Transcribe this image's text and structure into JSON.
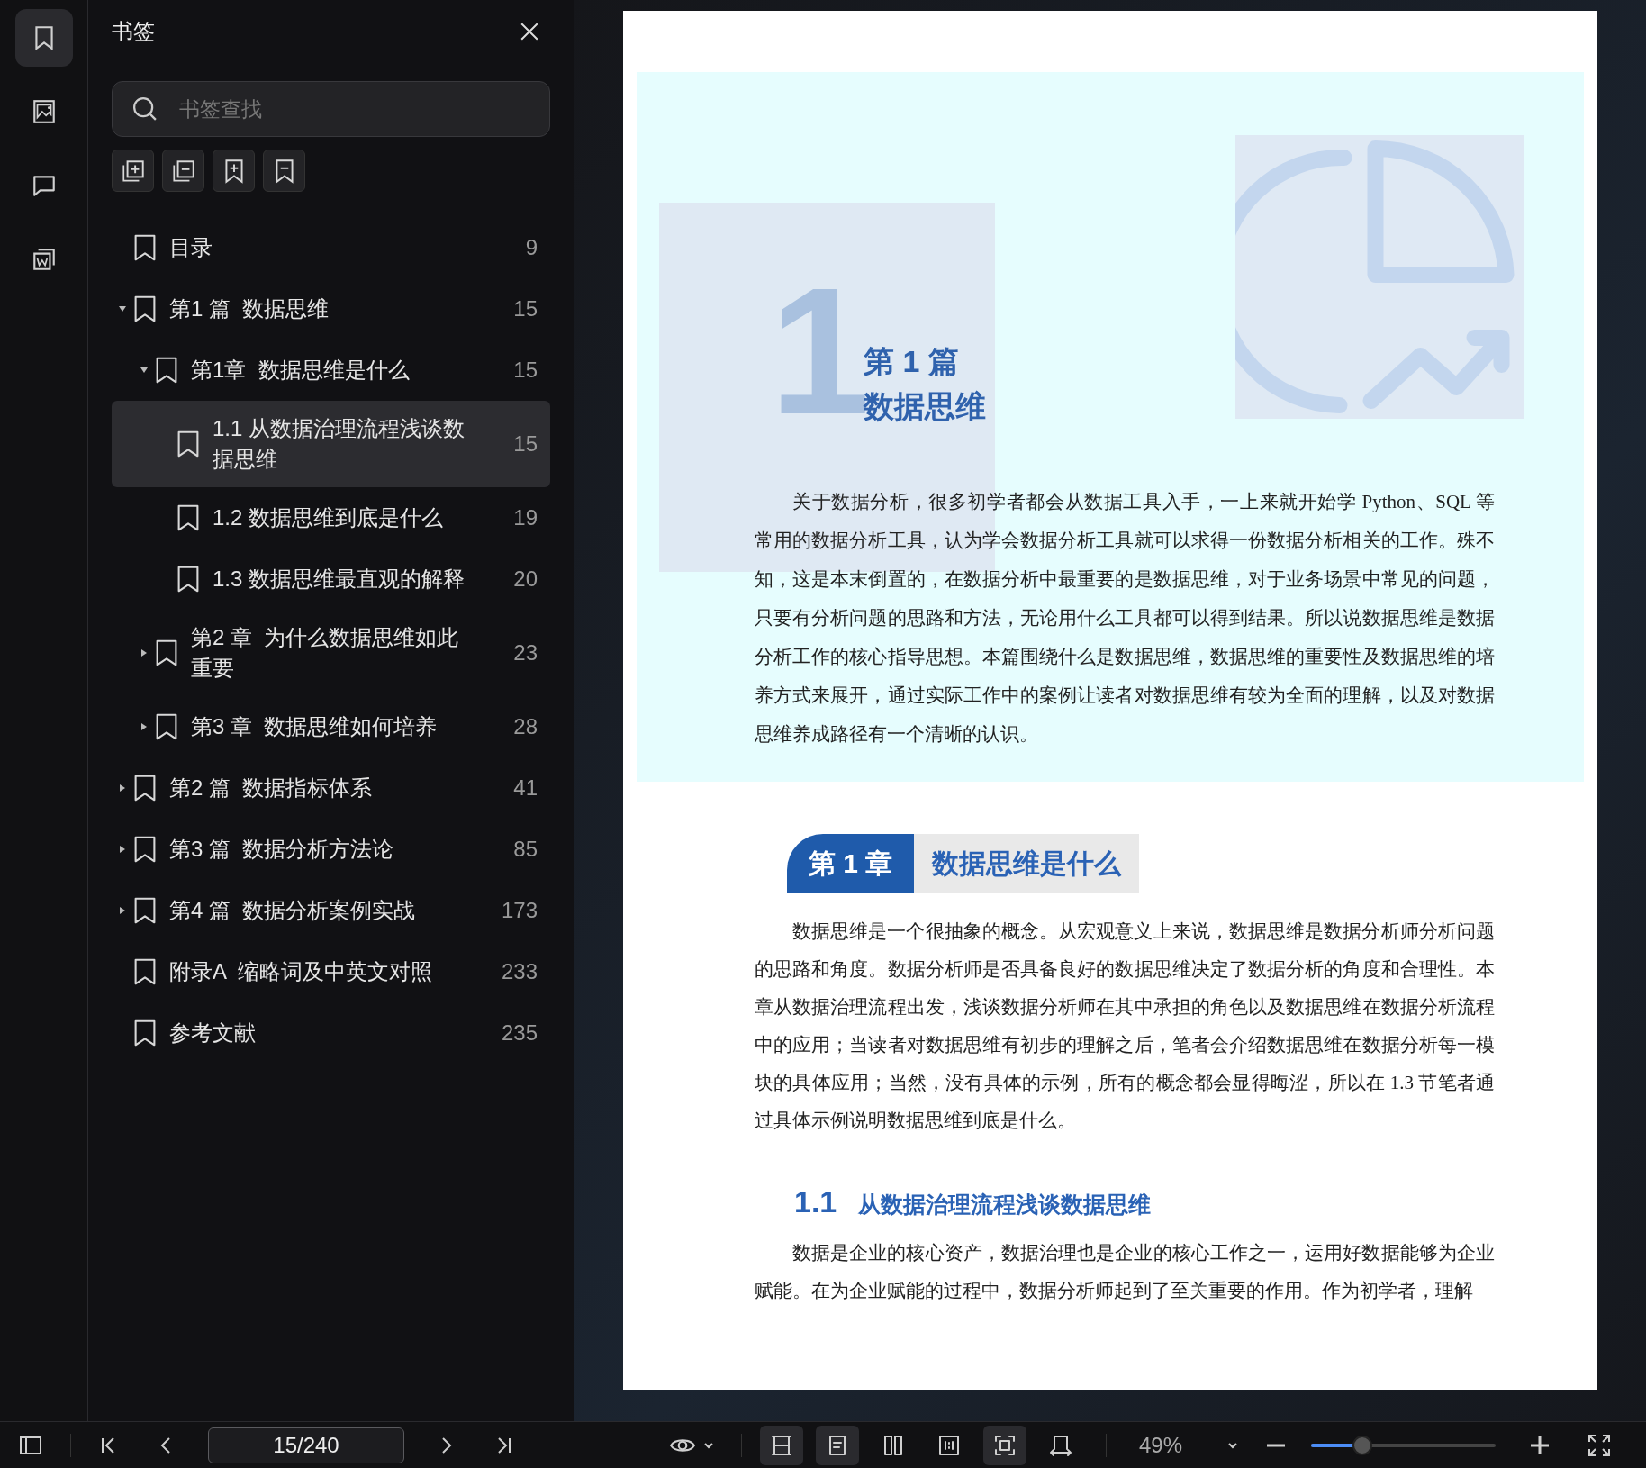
{
  "rail": [
    {
      "kind": "bookmark",
      "selected": true
    },
    {
      "kind": "image",
      "selected": false
    },
    {
      "kind": "comment",
      "selected": false
    },
    {
      "kind": "extract",
      "selected": false
    }
  ],
  "sidebar": {
    "title": "书签",
    "search": {
      "placeholder": "书签查找"
    },
    "tools": [
      {
        "kind": "expand-all"
      },
      {
        "kind": "collapse-all"
      },
      {
        "kind": "add-bookmark"
      },
      {
        "kind": "remove-bookmark"
      }
    ],
    "bookmarks": [
      {
        "title": "目录",
        "page": "9",
        "selected": false
      },
      {
        "title": "第1 篇  数据思维",
        "page": "15",
        "selected": false,
        "expanded": true,
        "children": [
          {
            "title": "第1章  数据思维是什么",
            "page": "15",
            "selected": false,
            "expanded": true,
            "children": [
              {
                "title": "1.1 从数据治理流程浅谈数据思维",
                "page": "15",
                "selected": true
              },
              {
                "title": "1.2 数据思维到底是什么",
                "page": "19",
                "selected": false
              },
              {
                "title": "1.3 数据思维最直观的解释",
                "page": "20",
                "selected": false
              }
            ]
          },
          {
            "title": "第2 章  为什么数据思维如此重要",
            "page": "23",
            "selected": false,
            "expanded": false
          },
          {
            "title": "第3 章  数据思维如何培养",
            "page": "28",
            "selected": false,
            "expanded": false
          }
        ]
      },
      {
        "title": "第2 篇  数据指标体系",
        "page": "41",
        "selected": false,
        "expanded": false
      },
      {
        "title": "第3 篇  数据分析方法论",
        "page": "85",
        "selected": false,
        "expanded": false
      },
      {
        "title": "第4 篇  数据分析案例实战",
        "page": "173",
        "selected": false,
        "expanded": false
      },
      {
        "title": "附录A  缩略词及中英文对照",
        "page": "233",
        "selected": false
      },
      {
        "title": "参考文献",
        "page": "235",
        "selected": false
      }
    ]
  },
  "page": {
    "part": {
      "number": "1",
      "label": "第 1 篇",
      "title": "数据思维",
      "intro": "关于数据分析，很多初学者都会从数据工具入手，一上来就开始学 Python、SQL 等常用的数据分析工具，认为学会数据分析工具就可以求得一份数据分析相关的工作。殊不知，这是本末倒置的，在数据分析中最重要的是数据思维，对于业务场景中常见的问题，只要有分析问题的思路和方法，无论用什么工具都可以得到结果。所以说数据思维是数据分析工作的核心指导思想。本篇围绕什么是数据思维，数据思维的重要性及数据思维的培养方式来展开，通过实际工作中的案例让读者对数据思维有较为全面的理解，以及对数据思维养成路径有一个清晰的认识。"
    },
    "chapter": {
      "label": "第 1 章",
      "title": "数据思维是什么",
      "text": "数据思维是一个很抽象的概念。从宏观意义上来说，数据思维是数据分析师分析问题的思路和角度。数据分析师是否具备良好的数据思维决定了数据分析的角度和合理性。本章从数据治理流程出发，浅谈数据分析师在其中承担的角色以及数据思维在数据分析流程中的应用；当读者对数据思维有初步的理解之后，笔者会介绍数据思维在数据分析每一模块的具体应用；当然，没有具体的示例，所有的概念都会显得晦涩，所以在 1.3 节笔者通过具体示例说明数据思维到底是什么。"
    },
    "section": {
      "number": "1.1",
      "title": "从数据治理流程浅谈数据思维",
      "text": "数据是企业的核心资产，数据治理也是企业的核心工作之一，运用好数据能够为企业赋能。在为企业赋能的过程中，数据分析师起到了至关重要的作用。作为初学者，理解"
    }
  },
  "toolbar": {
    "page_field": "15/240",
    "view_modes": [
      {
        "kind": "fit-width",
        "selected": true
      },
      {
        "kind": "single-page",
        "selected": true
      },
      {
        "kind": "two-page",
        "selected": false
      },
      {
        "kind": "actual-size",
        "selected": false
      },
      {
        "kind": "fit-page",
        "selected": true
      },
      {
        "kind": "rotate",
        "selected": false
      }
    ],
    "zoom": "49%",
    "zoom_slider": {
      "level": 0.28
    }
  }
}
